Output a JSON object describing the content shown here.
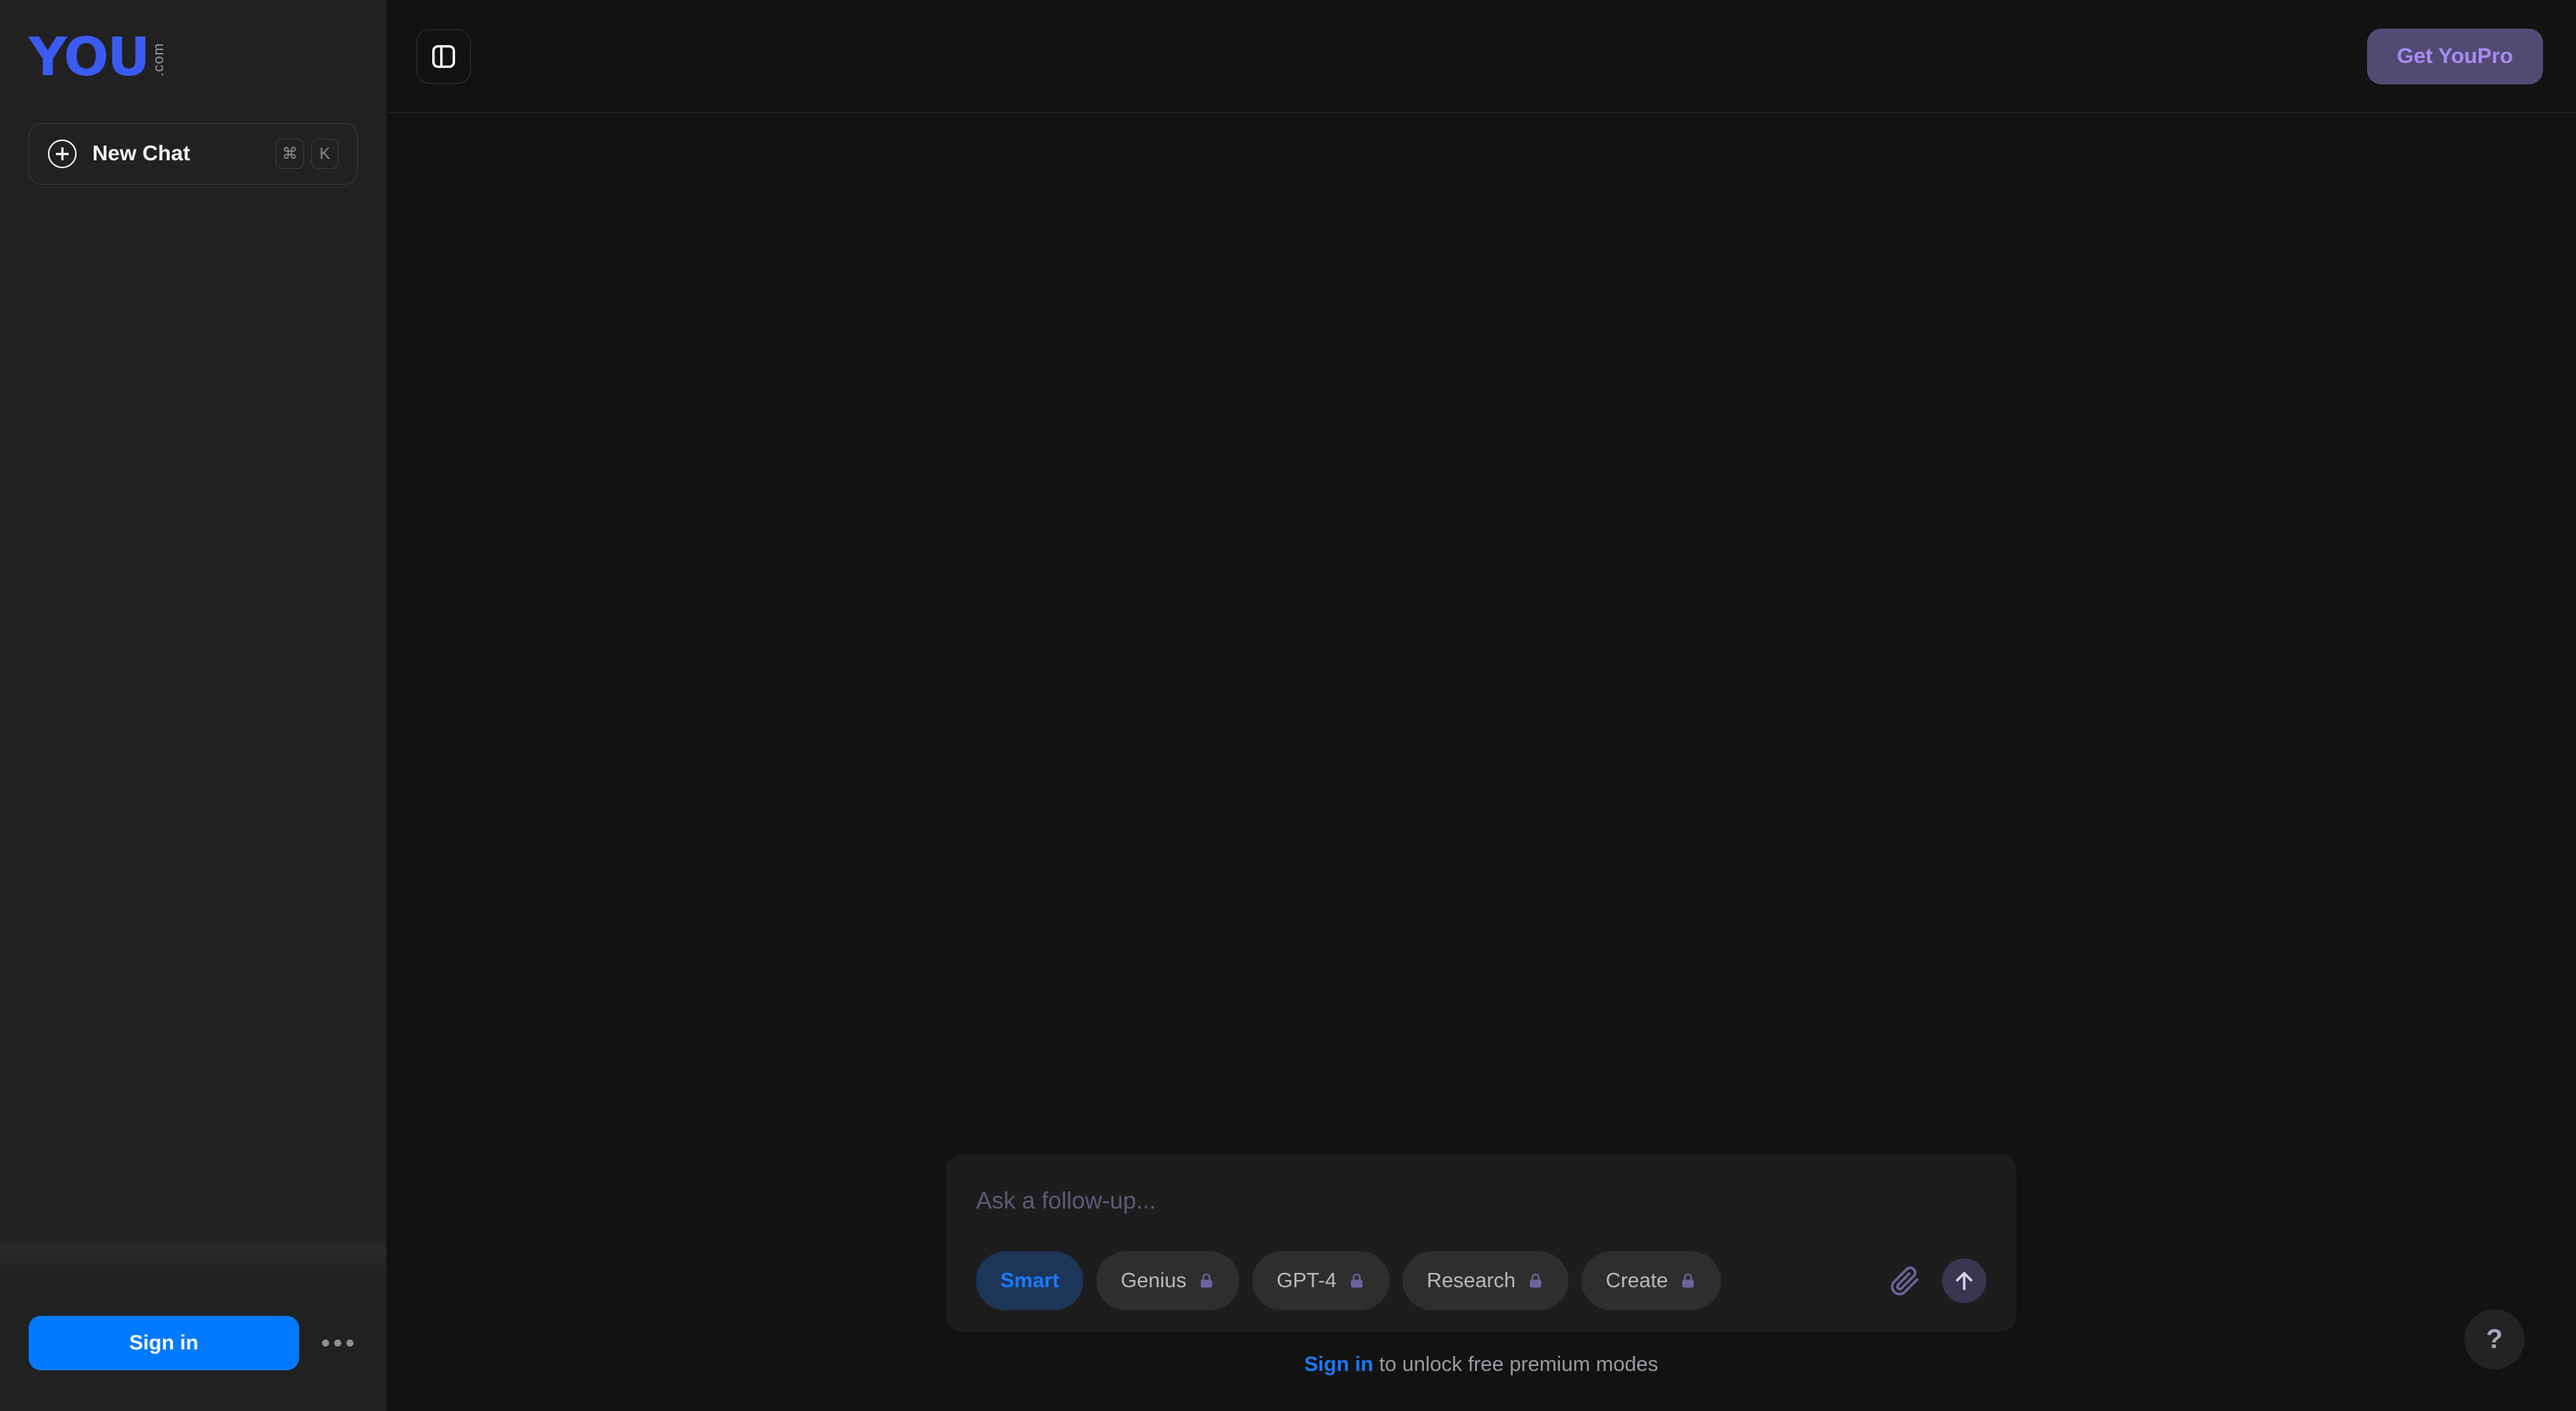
{
  "sidebar": {
    "logo": {
      "mark": "YOU",
      "tld": ".com",
      "icon": "you-logo-icon",
      "color": "#3b5bf5"
    },
    "new_chat": {
      "label": "New Chat",
      "icon": "plus-circle-icon",
      "shortcut_keys": [
        "⌘",
        "K"
      ]
    },
    "footer": {
      "signin_label": "Sign in",
      "more_icon": "more-horizontal-icon"
    }
  },
  "topbar": {
    "panel_toggle_icon": "sidebar-panel-toggle-icon",
    "youpro_label": "Get YouPro",
    "youpro_bg": "#534a73",
    "youpro_color": "#a28ef0"
  },
  "composer": {
    "placeholder": "Ask a follow-up...",
    "value": "",
    "modes": [
      {
        "label": "Smart",
        "locked": false,
        "active": true,
        "lock_icon": ""
      },
      {
        "label": "Genius",
        "locked": true,
        "active": false,
        "lock_icon": "lock-icon"
      },
      {
        "label": "GPT-4",
        "locked": true,
        "active": false,
        "lock_icon": "lock-icon"
      },
      {
        "label": "Research",
        "locked": true,
        "active": false,
        "lock_icon": "lock-icon"
      },
      {
        "label": "Create",
        "locked": true,
        "active": false,
        "lock_icon": "lock-icon"
      }
    ],
    "attach_icon": "paperclip-icon",
    "send_icon": "arrow-up-icon",
    "hint_link": "Sign in",
    "hint_rest": " to unlock free premium modes",
    "active_pill_bg": "#1c3559",
    "active_pill_color": "#1a7aff",
    "lock_color": "#6f639e"
  },
  "help": {
    "label": "?",
    "icon": "question-mark-icon"
  },
  "theme": {
    "sidebar_bg": "#212121",
    "main_bg": "#121212",
    "composer_bg": "#1d1d1d",
    "accent_blue": "#007aff"
  }
}
